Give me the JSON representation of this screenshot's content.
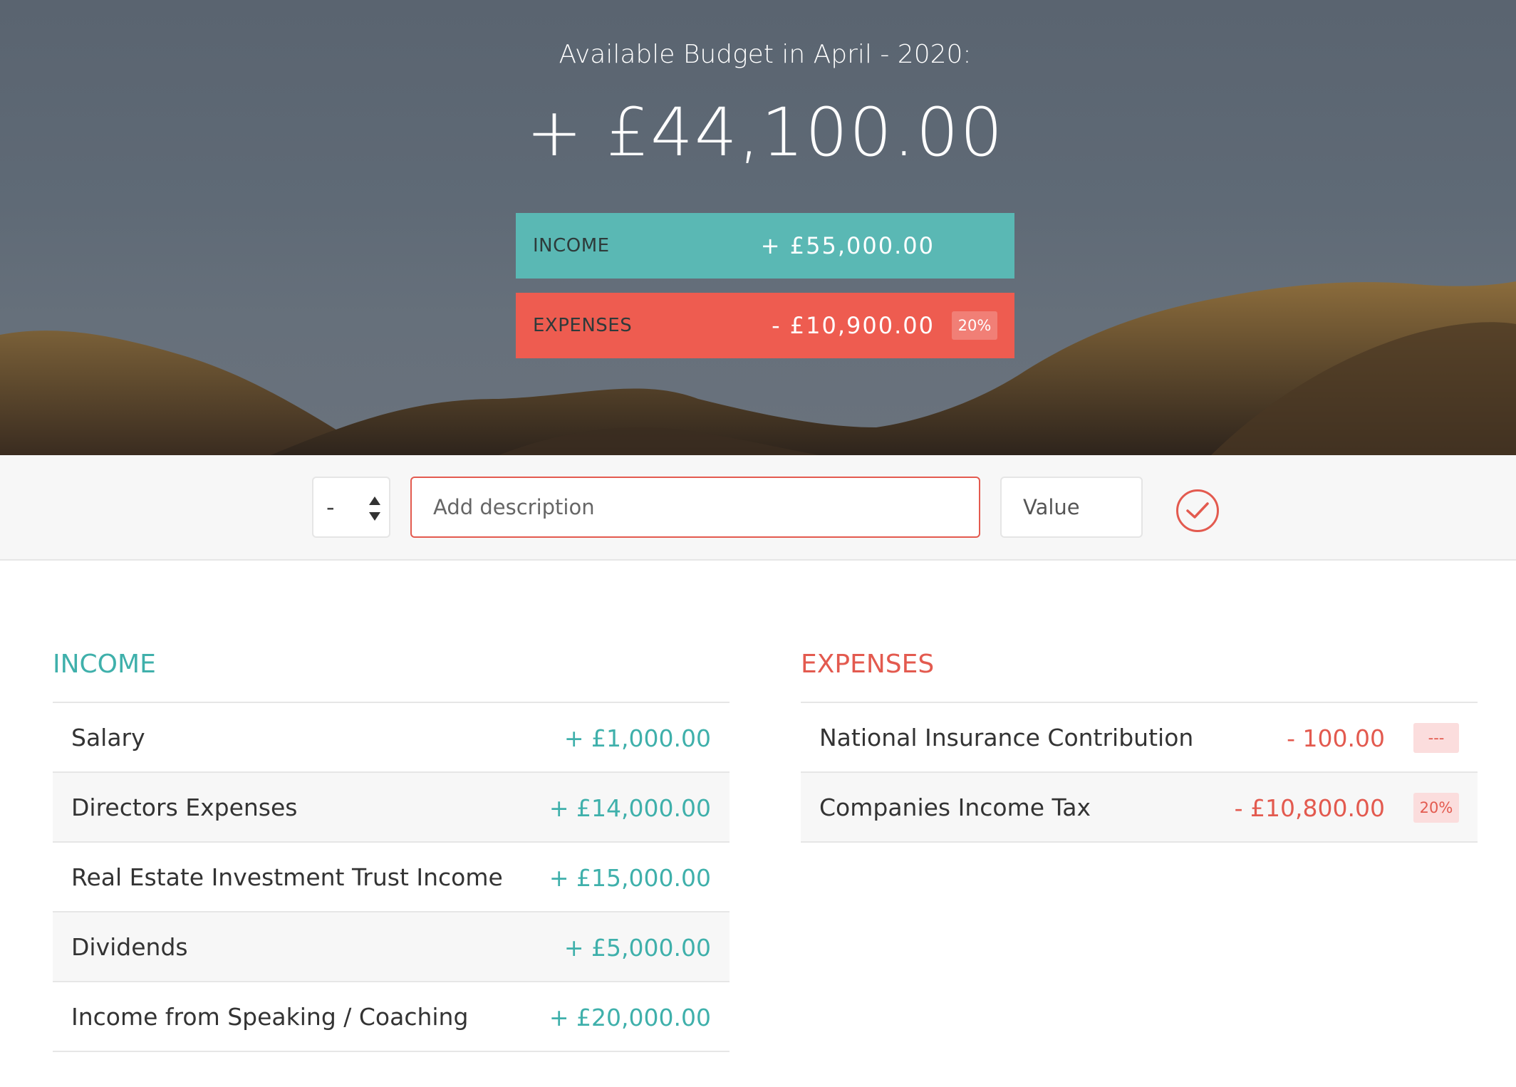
{
  "header": {
    "budget_title": "Available Budget in April - 2020:",
    "budget_value": "+ £44,100.00",
    "income_label": "Income",
    "income_value": "+ £55,000.00",
    "expenses_label": "Expenses",
    "expenses_value": "- £10,900.00",
    "expenses_percentage": "20%"
  },
  "add_bar": {
    "type_value": "-",
    "description_placeholder": "Add description",
    "value_placeholder": "Value",
    "add_button_icon": "check-circle-icon"
  },
  "income": {
    "title": "Income",
    "items": [
      {
        "description": "Salary",
        "value": "+ £1,000.00"
      },
      {
        "description": "Directors Expenses",
        "value": "+ £14,000.00"
      },
      {
        "description": "Real Estate Investment Trust Income",
        "value": "+ £15,000.00"
      },
      {
        "description": "Dividends",
        "value": "+ £5,000.00"
      },
      {
        "description": "Income from Speaking / Coaching",
        "value": "+ £20,000.00"
      }
    ]
  },
  "expenses": {
    "title": "Expenses",
    "items": [
      {
        "description": "National Insurance Contribution",
        "value": "- 100.00",
        "percentage": "---"
      },
      {
        "description": "Companies Income Tax",
        "value": "- £10,800.00",
        "percentage": "20%"
      }
    ]
  },
  "colors": {
    "income": "#3fb0ab",
    "income_bar": "#5ab8b4",
    "expenses": "#e35a4f",
    "expenses_bar": "#ee5c50"
  }
}
